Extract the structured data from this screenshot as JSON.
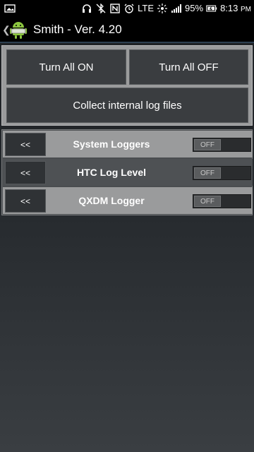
{
  "statusbar": {
    "network": "LTE",
    "battery_percent": "95%",
    "time": "8:13",
    "ampm": "PM",
    "icons": [
      "image-icon",
      "headset-icon",
      "bluetooth-off-icon",
      "nfc-icon",
      "alarm-icon",
      "data-sync-icon",
      "signal-icon",
      "battery-charging-icon"
    ]
  },
  "actionbar": {
    "title": "Smith - Ver. 4.20"
  },
  "controls": {
    "turn_all_on": "Turn All ON",
    "turn_all_off": "Turn All OFF",
    "collect_logs": "Collect internal log files"
  },
  "loggers": [
    {
      "expand_label": "<<",
      "name": "System Loggers",
      "state": "OFF"
    },
    {
      "expand_label": "<<",
      "name": "HTC Log Level",
      "state": "OFF"
    },
    {
      "expand_label": "<<",
      "name": "QXDM Logger",
      "state": "OFF"
    }
  ],
  "colors": {
    "accent_divider": "#2c3e4f",
    "panel_bg": "#9a9b9c",
    "button_bg": "#3a3d40"
  }
}
